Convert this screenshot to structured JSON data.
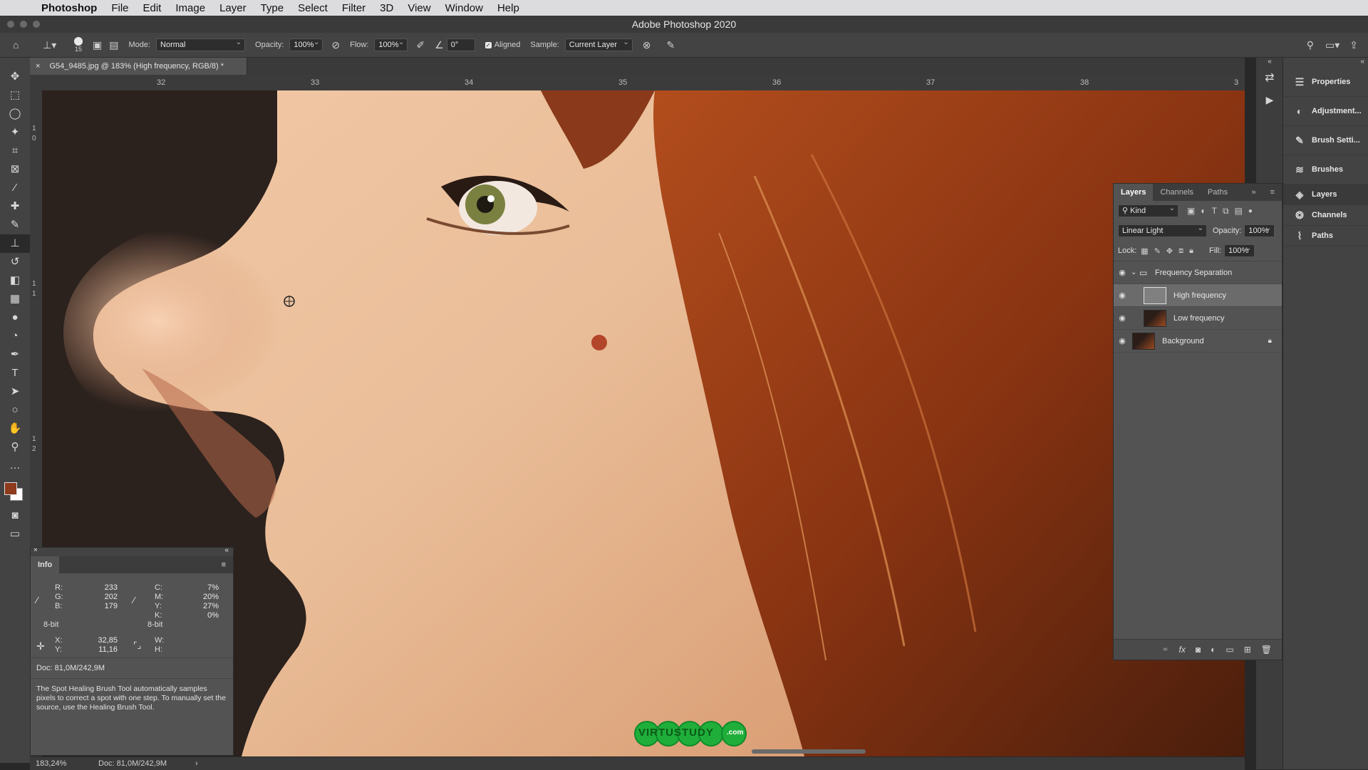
{
  "menubar": {
    "app": "Photoshop",
    "items": [
      "File",
      "Edit",
      "Image",
      "Layer",
      "Type",
      "Select",
      "Filter",
      "3D",
      "View",
      "Window",
      "Help"
    ]
  },
  "window": {
    "title": "Adobe Photoshop 2020"
  },
  "options": {
    "brush_size": "15",
    "mode_label": "Mode:",
    "mode_value": "Normal",
    "opacity_label": "Opacity:",
    "opacity_value": "100%",
    "flow_label": "Flow:",
    "flow_value": "100%",
    "angle_value": "0°",
    "aligned_label": "Aligned",
    "sample_label": "Sample:",
    "sample_value": "Current Layer"
  },
  "document": {
    "tab_title": "G54_9485.jpg @ 183% (High frequency, RGB/8) *"
  },
  "ruler": {
    "h": [
      "32",
      "33",
      "34",
      "35",
      "36",
      "37",
      "38",
      "3"
    ],
    "v": [
      "1",
      "0",
      "1",
      "1",
      "1",
      "2"
    ]
  },
  "statusbar": {
    "zoom": "183,24%",
    "doc": "Doc: 81,0M/242,9M",
    "arrow": "›"
  },
  "right_panels": [
    {
      "label": "Properties",
      "icon": "properties-icon",
      "glyph": "☰"
    },
    {
      "label": "Adjustment...",
      "icon": "adjustments-icon",
      "glyph": "◐"
    },
    {
      "label": "Brush Setti...",
      "icon": "brush-settings-icon",
      "glyph": "✎"
    },
    {
      "label": "Brushes",
      "icon": "brushes-icon",
      "glyph": "≋"
    },
    {
      "label": "Layers",
      "icon": "layers-icon",
      "glyph": "◈"
    },
    {
      "label": "Channels",
      "icon": "channels-icon",
      "glyph": "❂"
    },
    {
      "label": "Paths",
      "icon": "paths-icon",
      "glyph": "⌇"
    }
  ],
  "layers_panel": {
    "tabs": [
      "Layers",
      "Channels",
      "Paths"
    ],
    "filter_kind": "Kind",
    "blend_mode": "Linear Light",
    "opacity_label": "Opacity:",
    "opacity_value": "100%",
    "lock_label": "Lock:",
    "fill_label": "Fill:",
    "fill_value": "100%",
    "group_name": "Frequency Separation",
    "layers": [
      {
        "name": "High frequency",
        "selected": true
      },
      {
        "name": "Low frequency",
        "selected": false
      },
      {
        "name": "Background",
        "selected": false
      }
    ]
  },
  "info_panel": {
    "tab": "Info",
    "rgb": {
      "r_label": "R:",
      "g_label": "G:",
      "b_label": "B:",
      "r": "233",
      "g": "202",
      "b": "179",
      "bit": "8-bit"
    },
    "cmyk": {
      "c_label": "C:",
      "m_label": "M:",
      "y_label": "Y:",
      "k_label": "K:",
      "c": "7%",
      "m": "20%",
      "y": "27%",
      "k": "0%",
      "bit": "8-bit"
    },
    "xy": {
      "x_label": "X:",
      "y_label": "Y:",
      "x": "32,85",
      "y": "11,16"
    },
    "wh": {
      "w_label": "W:",
      "h_label": "H:"
    },
    "doc": "Doc: 81,0M/242,9M",
    "hint": "The Spot Healing Brush Tool automatically samples pixels to correct a spot with one step. To manually set the source, use the Healing Brush Tool."
  },
  "watermark": {
    "text": "VIRTUSTUDY",
    "suffix": ".com"
  },
  "colors": {
    "foreground": "#8e3a1c",
    "background": "#ffffff",
    "accent": "#1fae3a"
  }
}
